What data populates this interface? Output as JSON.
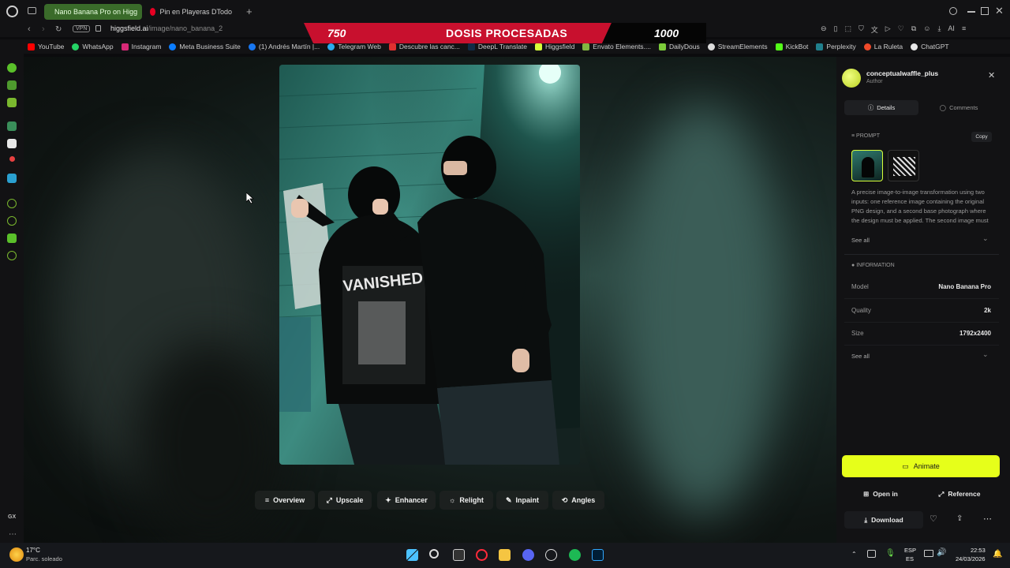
{
  "tabs": [
    {
      "label": "Nano Banana Pro on Higg",
      "active": true
    },
    {
      "label": "Pin en Playeras DTodo",
      "active": false
    }
  ],
  "address": {
    "vpn": "VPN",
    "host": "higgsfield.ai",
    "path": "/image/nano_banana_2"
  },
  "banner": {
    "left": "750",
    "center": "DOSIS PROCESADAS",
    "right": "1000"
  },
  "bookmarks": [
    "YouTube",
    "WhatsApp",
    "Instagram",
    "Meta Business Suite",
    "(1) Andrés Martín |...",
    "Telegram Web",
    "Descubre las canc...",
    "DeepL Translate",
    "Higgsfield",
    "Envato Elements....",
    "DailyDous",
    "StreamElements",
    "KickBot",
    "Perplexity",
    "La Ruleta",
    "ChatGPT"
  ],
  "sidebar_bottom": "GX",
  "toolbar": [
    "Overview",
    "Upscale",
    "Enhancer",
    "Relight",
    "Inpaint",
    "Angles"
  ],
  "panel": {
    "author_name": "conceptualwaffle_plus",
    "author_role": "Author",
    "tab_details": "Details",
    "tab_comments": "Comments",
    "prompt_label": "PROMPT",
    "copy": "Copy",
    "prompt_text": "A precise image-to-image transformation using two inputs: one reference image containing the original PNG design, and a second base photograph where the design must be applied. The second image must remain completely",
    "see_all_1": "See all",
    "info_label": "INFORMATION",
    "info": [
      {
        "k": "Model",
        "v": "Nano Banana Pro"
      },
      {
        "k": "Quality",
        "v": "2k"
      },
      {
        "k": "Size",
        "v": "1792x2400"
      }
    ],
    "see_all_2": "See all",
    "animate": "Animate",
    "open_in": "Open in",
    "reference": "Reference",
    "download": "Download"
  },
  "shirt_text": "VANISHED",
  "weather": {
    "temp": "17°C",
    "desc": "Parc. soleado"
  },
  "tray": {
    "lang1": "ESP",
    "lang2": "ES",
    "time": "22:53",
    "date": "24/03/2026"
  },
  "colors": {
    "accent": "#e6ff1a",
    "banner_red": "#c8102e",
    "tab_green": "#3a6b2a"
  }
}
